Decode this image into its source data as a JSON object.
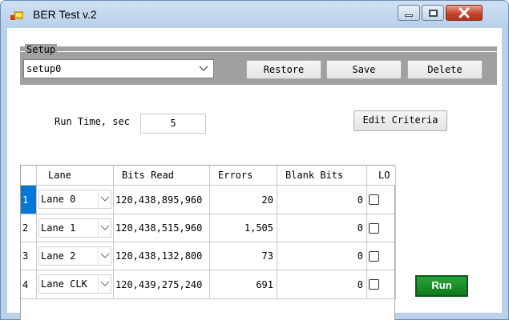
{
  "window": {
    "title": "BER Test  v.2",
    "colors": {
      "run_button": "#118a22",
      "selected_row": "#0078d7",
      "groupbox": "#a0a0a0"
    }
  },
  "setup": {
    "group_label": "Setup",
    "selected": "setup0",
    "buttons": {
      "restore": "Restore",
      "save": "Save",
      "delete": "Delete"
    }
  },
  "runtime": {
    "label": "Run Time, sec",
    "value": "5"
  },
  "edit_criteria": "Edit Criteria",
  "grid": {
    "headers": {
      "lane": "Lane",
      "bits_read": "Bits Read",
      "errors": "Errors",
      "blank_bits": "Blank Bits",
      "lo": "LO"
    },
    "rows": [
      {
        "index": "1",
        "lane": "Lane 0",
        "bits_read": "120,438,895,960",
        "errors": "20",
        "blank_bits": "0",
        "lo_checked": false
      },
      {
        "index": "2",
        "lane": "Lane 1",
        "bits_read": "120,438,515,960",
        "errors": "1,505",
        "blank_bits": "0",
        "lo_checked": false
      },
      {
        "index": "3",
        "lane": "Lane 2",
        "bits_read": "120,438,132,800",
        "errors": "73",
        "blank_bits": "0",
        "lo_checked": false
      },
      {
        "index": "4",
        "lane": "Lane CLK",
        "bits_read": "120,439,275,240",
        "errors": "691",
        "blank_bits": "0",
        "lo_checked": false
      }
    ]
  },
  "run_button": "Run"
}
